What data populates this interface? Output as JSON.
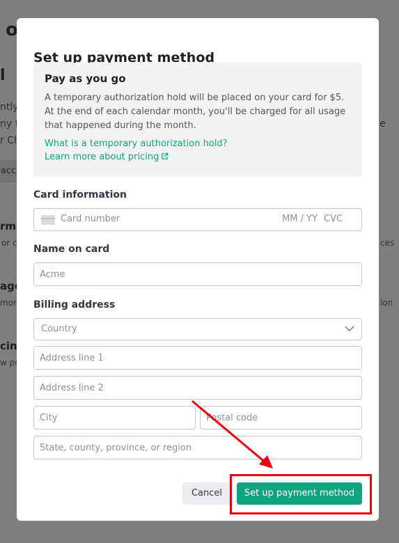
{
  "background": {
    "fragments": {
      "f1": "o",
      "f2": "l",
      "f3": "ntly",
      "f4": "ny f",
      "f5": "r Ch",
      "f6": "acco",
      "f7": "rme",
      "f8": "or c",
      "f9": "age",
      "f10": "mor",
      "f11": "cing",
      "f12": "w pri",
      "r1": "e",
      "r2": "ces",
      "r3": "ion"
    }
  },
  "modal": {
    "title": "Set up payment method",
    "info": {
      "title": "Pay as you go",
      "text": "A temporary authorization hold will be placed on your card for $5. At the end of each calendar month, you'll be charged for all usage that happened during the month.",
      "link_hold": "What is a temporary authorization hold?",
      "link_pricing": "Learn more about pricing"
    },
    "card": {
      "label": "Card information",
      "number_placeholder": "Card number",
      "exp_placeholder": "MM / YY",
      "cvc_placeholder": "CVC"
    },
    "name": {
      "label": "Name on card",
      "placeholder": "Acme"
    },
    "billing": {
      "label": "Billing address",
      "country": "Country",
      "line1": "Address line 1",
      "line2": "Address line 2",
      "city": "City",
      "postal": "Postal code",
      "state": "State, county, province, or region"
    },
    "buttons": {
      "cancel": "Cancel",
      "submit": "Set up payment method"
    }
  },
  "colors": {
    "accent": "#10a37f",
    "overlay": "#7f7f7f",
    "annotation": "#e8000b"
  }
}
